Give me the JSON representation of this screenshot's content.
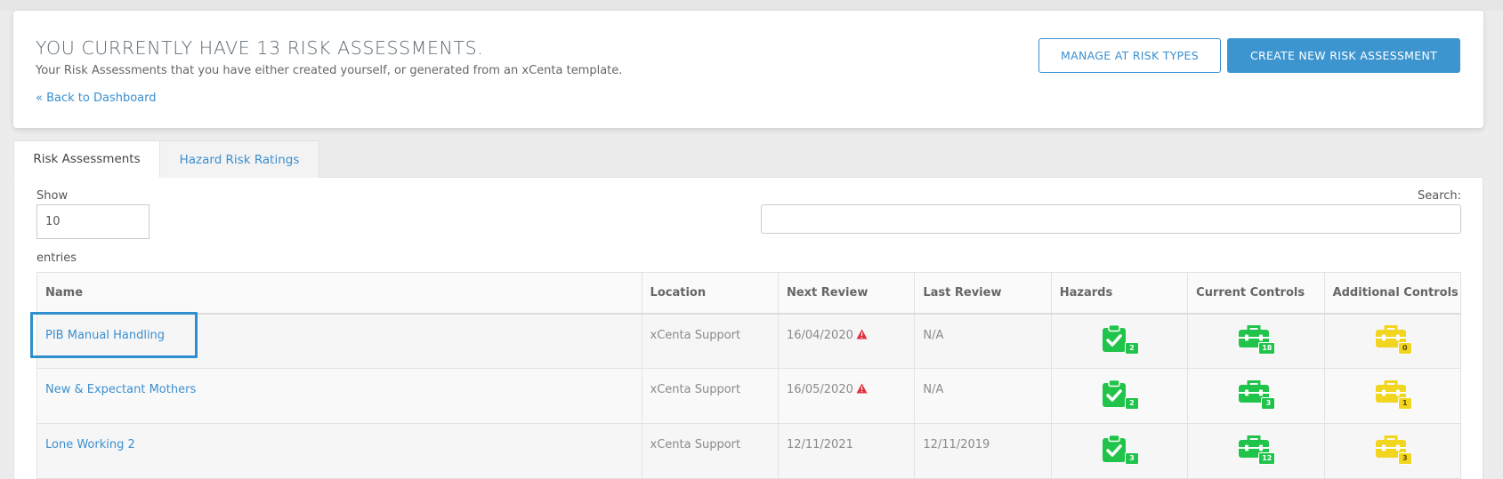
{
  "header": {
    "title": "YOU CURRENTLY HAVE 13 RISK ASSESSMENTS.",
    "subtitle": "Your Risk Assessments that you have either created yourself, or generated from an xCenta template.",
    "back_link": "« Back to Dashboard",
    "manage_button": "MANAGE AT RISK TYPES",
    "create_button": "CREATE NEW RISK ASSESSMENT"
  },
  "tabs": [
    {
      "label": "Risk Assessments",
      "active": true
    },
    {
      "label": "Hazard Risk Ratings",
      "active": false
    }
  ],
  "controls": {
    "show_label": "Show",
    "show_value": "10",
    "entries_label": "entries",
    "search_label": "Search:",
    "search_value": ""
  },
  "table": {
    "columns": [
      "Name",
      "Location",
      "Next Review",
      "Last Review",
      "Hazards",
      "Current Controls",
      "Additional Controls"
    ],
    "rows": [
      {
        "name": "PIB Manual Handling",
        "location": "xCenta Support",
        "next_review": "16/04/2020",
        "overdue": true,
        "last_review": "N/A",
        "hazards": "2",
        "current_controls": "18",
        "additional_controls": "0"
      },
      {
        "name": "New & Expectant Mothers",
        "location": "xCenta Support",
        "next_review": "16/05/2020",
        "overdue": true,
        "last_review": "N/A",
        "hazards": "2",
        "current_controls": "3",
        "additional_controls": "1"
      },
      {
        "name": "Lone Working 2",
        "location": "xCenta Support",
        "next_review": "12/11/2021",
        "overdue": false,
        "last_review": "12/11/2019",
        "hazards": "3",
        "current_controls": "12",
        "additional_controls": "3"
      }
    ]
  },
  "colors": {
    "accent": "#3d95d0",
    "link": "#3a8fcf",
    "hazard_green": "#21c44a",
    "additional_yellow": "#f2d51e",
    "warning_red": "#e0303c"
  },
  "icons": {
    "hazards": "clipboard-check-icon",
    "current_controls": "toolbox-icon",
    "additional_controls": "toolbox-icon",
    "overdue": "warning-triangle-icon"
  }
}
